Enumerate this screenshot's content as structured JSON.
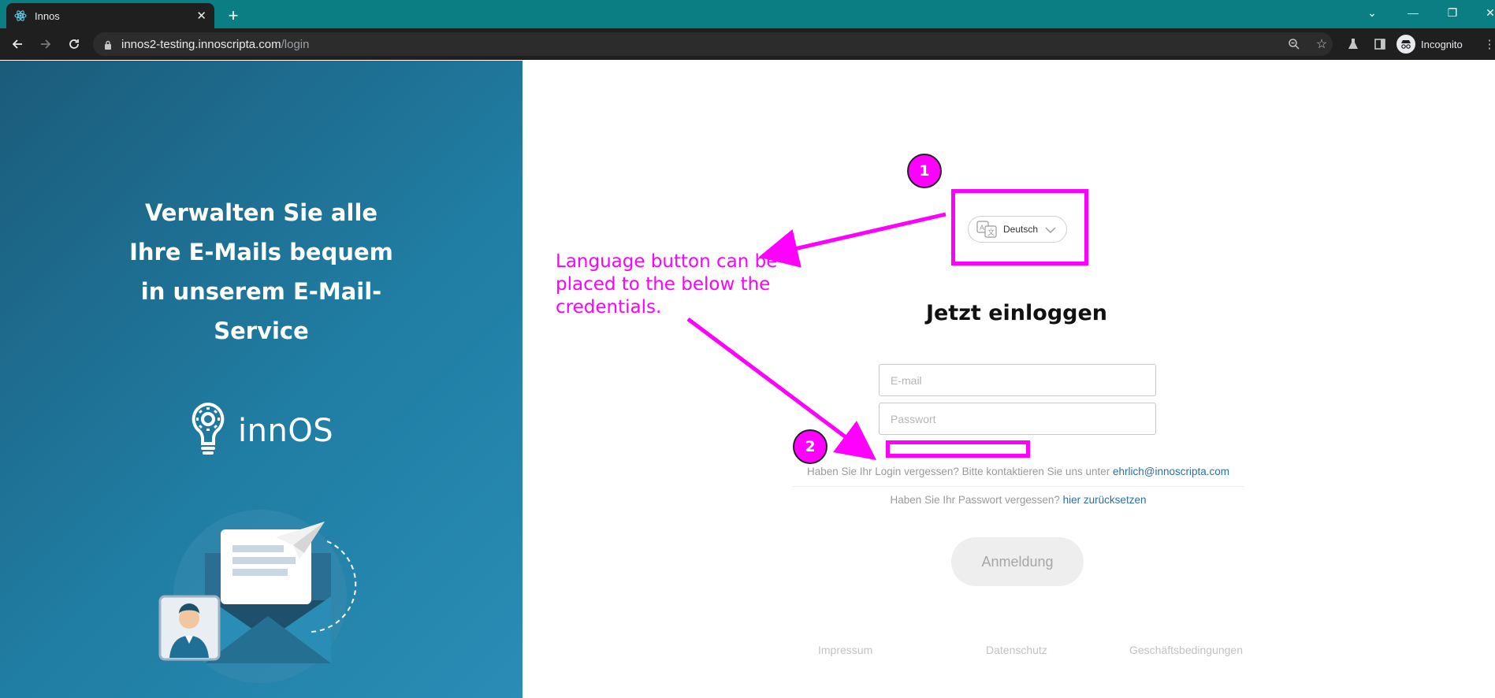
{
  "browser": {
    "tab_title": "Innos",
    "tab_close": "✕",
    "new_tab": "+",
    "url_host": "innos2-testing.innoscripta.com",
    "url_path": "/login",
    "incognito_label": "Incognito"
  },
  "hero": {
    "line1": "Verwalten Sie alle",
    "line2": "Ihre E-Mails bequem",
    "line3": "in unserem E-Mail-",
    "line4": "Service"
  },
  "logo": {
    "wordmark": "innOS"
  },
  "login": {
    "language_label": "Deutsch",
    "heading": "Jetzt einloggen",
    "email_placeholder": "E-mail",
    "password_placeholder": "Passwort",
    "forgot_login_text": "Haben Sie Ihr Login vergessen? Bitte kontaktieren Sie uns unter ",
    "forgot_login_email": "ehrlich@innoscripta.com",
    "forgot_password_text": "Haben Sie Ihr Passwort vergessen? ",
    "forgot_password_link": "hier zurücksetzen",
    "submit_label": "Anmeldung"
  },
  "footer": {
    "impressum": "Impressum",
    "datenschutz": "Datenschutz",
    "agb": "Geschäftsbedingungen"
  },
  "annotations": {
    "badge1": "1",
    "badge2": "2",
    "note_line1": "Language button can be",
    "note_line2": "placed to the below the",
    "note_line3": "credentials.",
    "color": "#ff00ff"
  },
  "colors": {
    "tabbar": "#0a7e82",
    "chrome_dark": "#1f1f1f",
    "panel_blue": "#207da3",
    "link": "#2e6fa3"
  }
}
